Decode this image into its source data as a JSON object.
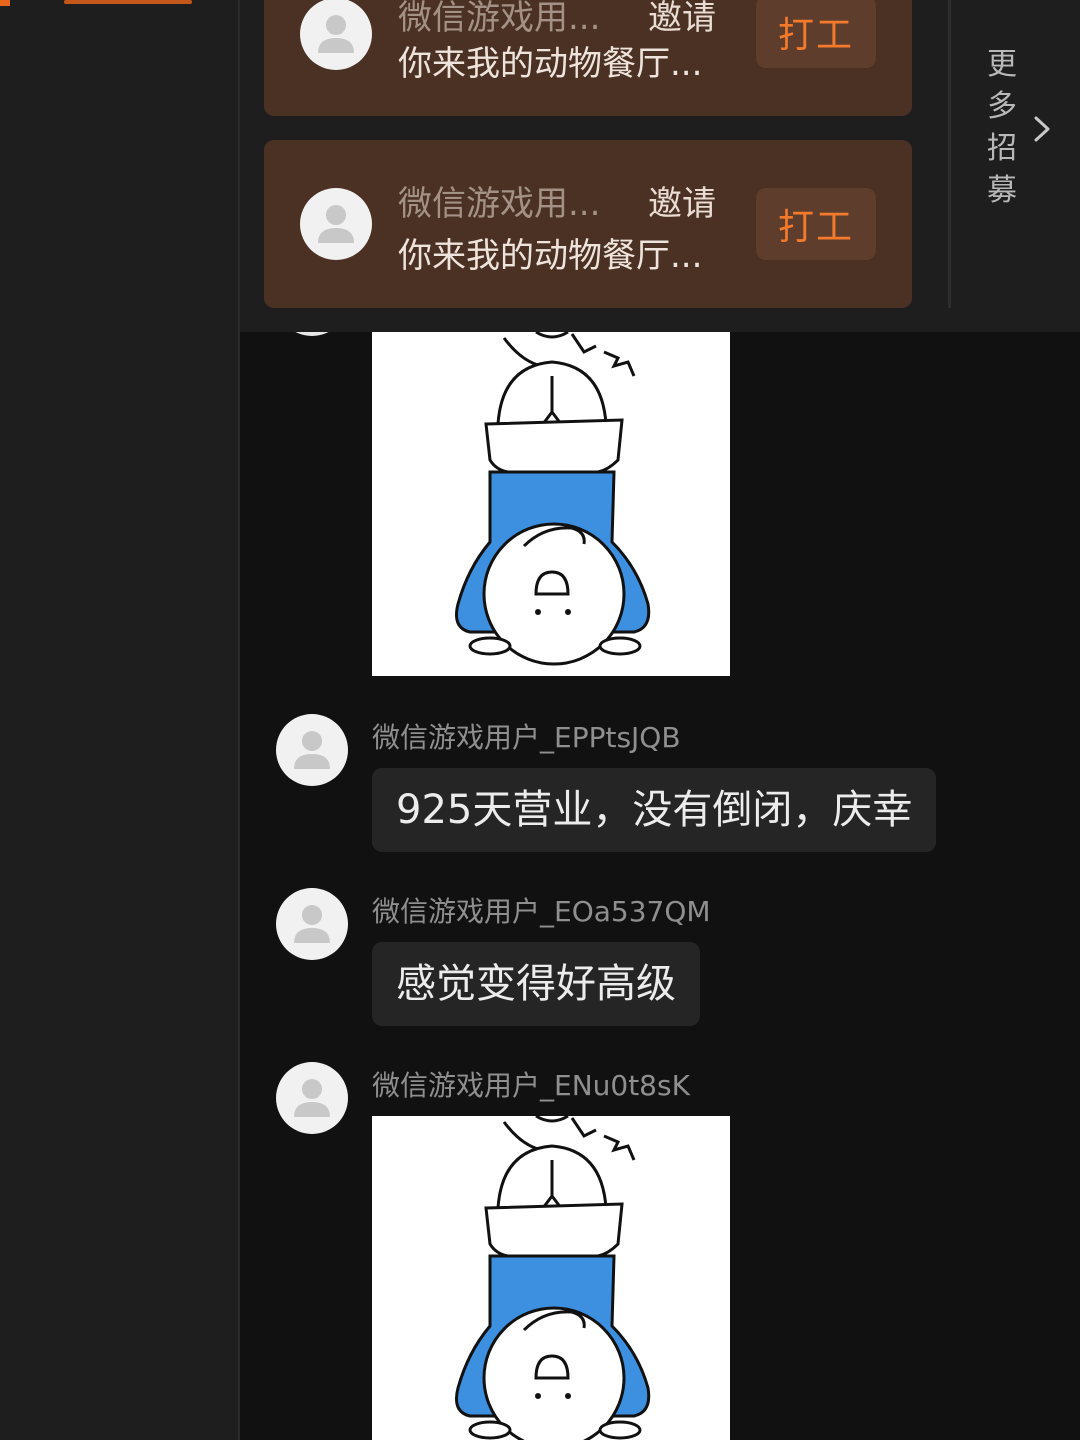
{
  "recruit": {
    "cards": [
      {
        "name": "微信游戏用...",
        "invite": "邀请",
        "desc": "你来我的动物餐厅...",
        "button": "打工"
      },
      {
        "name": "微信游戏用...",
        "invite": "邀请",
        "desc": "你来我的动物餐厅...",
        "button": "打工"
      }
    ],
    "more_label": "更多招募"
  },
  "chat": {
    "messages": [
      {
        "user": "微信游戏用户_EPPtsJQB",
        "text": "925天营业，没有倒闭，庆幸"
      },
      {
        "user": "微信游戏用户_EOa537QM",
        "text": "感觉变得好高级"
      },
      {
        "user": "微信游戏用户_ENu0t8sK",
        "sticker": "upside-down-cartoon-sticker"
      }
    ]
  },
  "colors": {
    "accent": "#f27a2a",
    "card_bg": "#4a3124",
    "sticker_blue": "#3d8fe0"
  }
}
